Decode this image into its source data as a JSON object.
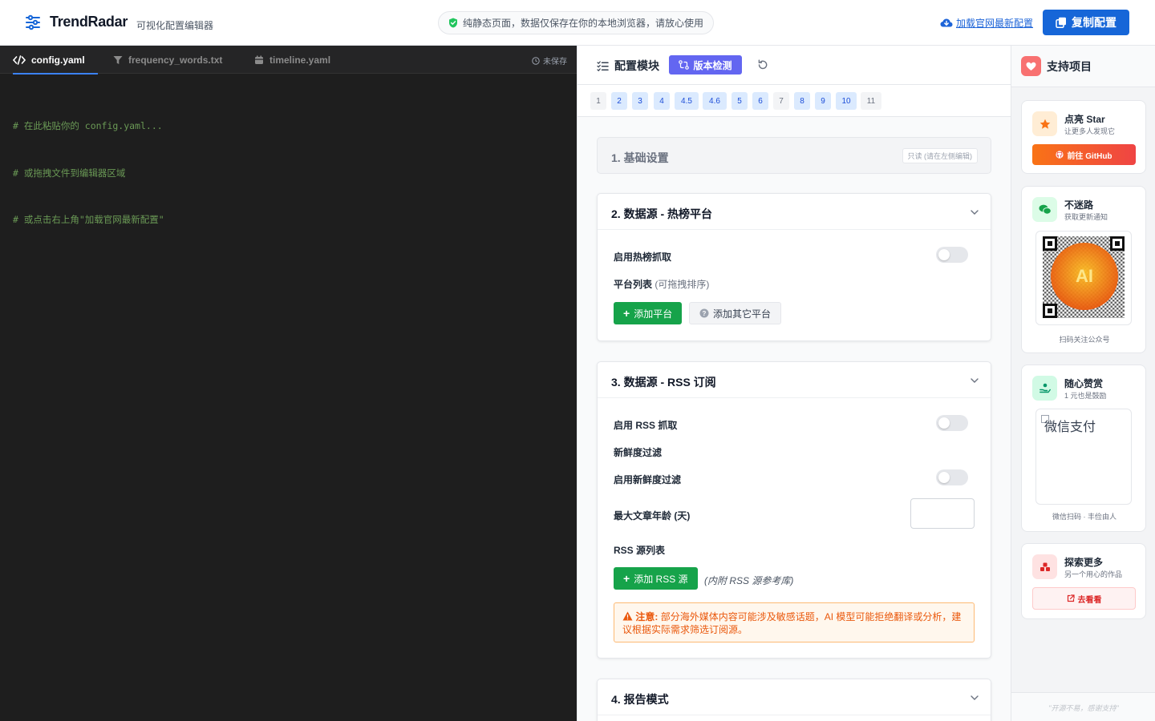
{
  "header": {
    "brand": "TrendRadar",
    "subtitle": "可视化配置编辑器",
    "notice": "纯静态页面，数据仅保存在你的本地浏览器，请放心使用",
    "load_link": "加载官网最新配置",
    "copy_button": "复制配置"
  },
  "editor": {
    "tabs": [
      {
        "label": "config.yaml",
        "icon": "code-icon",
        "active": true
      },
      {
        "label": "frequency_words.txt",
        "icon": "filter-icon",
        "active": false
      },
      {
        "label": "timeline.yaml",
        "icon": "calendar-icon",
        "active": false
      }
    ],
    "status": "未保存",
    "code_lines": [
      "# 在此粘贴你的 config.yaml...",
      "# 或拖拽文件到编辑器区域",
      "# 或点击右上角\"加载官网最新配置\""
    ]
  },
  "config": {
    "title": "配置模块",
    "version_button": "版本检测",
    "nav": [
      {
        "label": "1",
        "state": "off"
      },
      {
        "label": "2",
        "state": "on"
      },
      {
        "label": "3",
        "state": "on"
      },
      {
        "label": "4",
        "state": "on"
      },
      {
        "label": "4.5",
        "state": "on"
      },
      {
        "label": "4.6",
        "state": "on"
      },
      {
        "label": "5",
        "state": "on"
      },
      {
        "label": "6",
        "state": "on"
      },
      {
        "label": "7",
        "state": "off"
      },
      {
        "label": "8",
        "state": "on"
      },
      {
        "label": "9",
        "state": "on"
      },
      {
        "label": "10",
        "state": "on"
      },
      {
        "label": "11",
        "state": "off"
      }
    ],
    "section1": {
      "title": "1. 基础设置",
      "badge": "只读 (请在左侧编辑)"
    },
    "section2": {
      "title": "2. 数据源 - 热榜平台",
      "enable_label": "启用热榜抓取",
      "list_label": "平台列表",
      "list_hint": "(可拖拽排序)",
      "add_platform": "添加平台",
      "add_other": "添加其它平台"
    },
    "section3": {
      "title": "3. 数据源 - RSS 订阅",
      "enable_label": "启用 RSS 抓取",
      "freshness_label": "新鲜度过滤",
      "freshness_enable": "启用新鲜度过滤",
      "max_age_label": "最大文章年龄 (天)",
      "max_age_value": "",
      "list_label": "RSS 源列表",
      "add_rss": "添加 RSS 源",
      "add_rss_hint": "(内附 RSS 源参考库)",
      "warn_prefix": "注意:",
      "warn_text": "部分海外媒体内容可能涉及敏感话题，AI 模型可能拒绝翻译或分析，建议根据实际需求筛选订阅源。"
    },
    "section4": {
      "title": "4. 报告模式"
    }
  },
  "sidebar": {
    "title": "支持项目",
    "star": {
      "title": "点亮 Star",
      "sub": "让更多人发现它",
      "button": "前往 GitHub"
    },
    "follow": {
      "title": "不迷路",
      "sub": "获取更新通知",
      "qr_text": "AI",
      "caption": "扫码关注公众号"
    },
    "donate": {
      "title": "随心赞赏",
      "sub": "1 元也是鼓励",
      "image_alt": "微信支付",
      "caption": "微信扫码 · 丰俭由人"
    },
    "explore": {
      "title": "探索更多",
      "sub": "另一个用心的作品",
      "button": "去看看"
    },
    "footer": "\"开源不易，感谢支持\""
  },
  "colors": {
    "primary": "#1666d8",
    "violet": "#6366f1",
    "green": "#16a34a",
    "warning": "#ea580c",
    "editor_bg": "#1e1e1e"
  }
}
